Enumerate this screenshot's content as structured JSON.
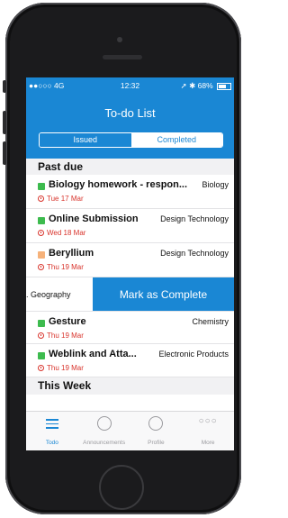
{
  "status_bar": {
    "carrier": "●●○○○ 4G",
    "time": "12:32",
    "battery": "68%"
  },
  "nav": {
    "title": "To-do List"
  },
  "segment": {
    "issued": "Issued",
    "completed": "Completed"
  },
  "sections": {
    "past_due": "Past due",
    "this_week": "This Week"
  },
  "items": [
    {
      "title": "Biology homework - respon...",
      "subject": "Biology",
      "date": "Tue 17 Mar",
      "color": "#3dbb4e"
    },
    {
      "title": "Online Submission",
      "subject": "Design Technology",
      "date": "Wed 18 Mar",
      "color": "#3dbb4e"
    },
    {
      "title": "Beryllium",
      "subject": "Design Technology",
      "date": "Thu 19 Mar",
      "color": "#f6b27a"
    },
    {
      "title": "Gesture",
      "subject": "Chemistry",
      "date": "Thu 19 Mar",
      "color": "#3dbb4e"
    },
    {
      "title": "Weblink and Atta...",
      "subject": "Electronic Products",
      "date": "Thu 19 Mar",
      "color": "#3dbb4e"
    }
  ],
  "swiped_row": {
    "subject": ". Geography",
    "action": "Mark as Complete"
  },
  "tabs": [
    {
      "label": "Todo",
      "icon": "list-icon",
      "active": true
    },
    {
      "label": "Announcements",
      "icon": "megaphone-icon",
      "active": false
    },
    {
      "label": "Profile",
      "icon": "profile-icon",
      "active": false
    },
    {
      "label": "More",
      "icon": "more-icon",
      "active": false
    }
  ],
  "colors": {
    "accent": "#1a87d4",
    "overdue": "#d8332b"
  }
}
